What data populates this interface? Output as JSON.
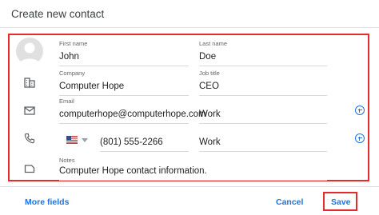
{
  "dialog": {
    "title": "Create new contact"
  },
  "fields": {
    "first_name": {
      "label": "First name",
      "value": "John"
    },
    "last_name": {
      "label": "Last name",
      "value": "Doe"
    },
    "company": {
      "label": "Company",
      "value": "Computer Hope"
    },
    "job_title": {
      "label": "Job title",
      "value": "CEO"
    },
    "email": {
      "label": "Email",
      "value": "computerhope@computerhope.com",
      "type": "Work"
    },
    "phone": {
      "country": "US",
      "value": "(801) 555-2266",
      "type": "Work"
    },
    "notes": {
      "label": "Notes",
      "value": "Computer Hope contact information."
    }
  },
  "footer": {
    "more_fields": "More fields",
    "cancel": "Cancel",
    "save": "Save"
  },
  "colors": {
    "accent": "#1a73e8",
    "highlight": "#e52b2b"
  }
}
